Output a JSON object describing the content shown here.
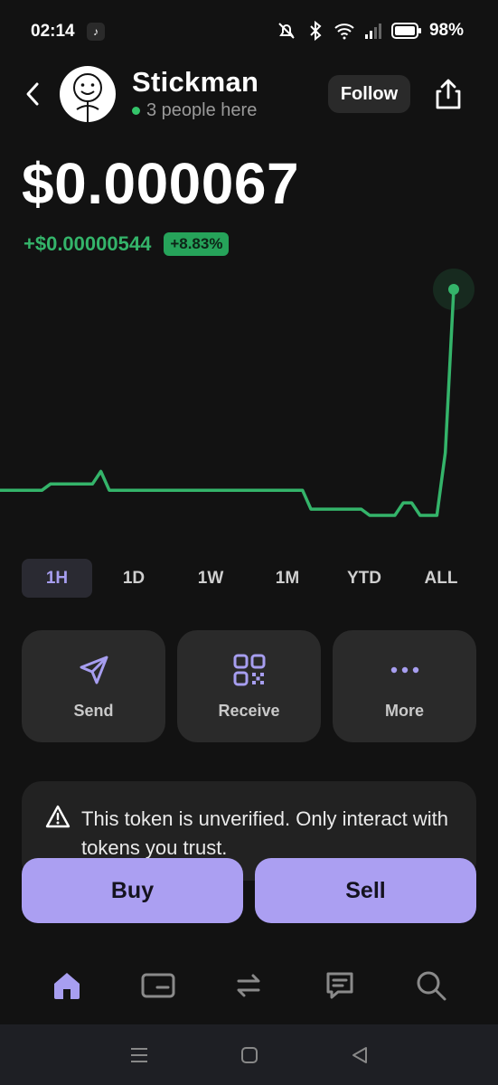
{
  "status_bar": {
    "time": "02:14",
    "battery": "98%",
    "icons": [
      "tiktok-icon",
      "mute-bell-icon",
      "bluetooth-icon",
      "wifi-icon",
      "signal-icon",
      "battery-icon"
    ]
  },
  "header": {
    "back_icon": "chevron-left-icon",
    "title": "Stickman",
    "presence": "3 people here",
    "follow_label": "Follow",
    "share_icon": "share-icon"
  },
  "token": {
    "price": "$0.000067",
    "change_abs": "+$0.00000544",
    "change_pct": "+8.83%"
  },
  "chart_data": {
    "type": "line",
    "color": "#34b46a",
    "values": [
      50,
      50,
      50,
      50,
      50,
      50,
      51,
      51,
      51,
      51,
      51,
      51,
      53,
      50,
      50,
      50,
      50,
      50,
      50,
      50,
      50,
      50,
      50,
      50,
      50,
      50,
      50,
      50,
      50,
      50,
      50,
      50,
      50,
      50,
      50,
      50,
      50,
      47,
      47,
      47,
      47,
      47,
      47,
      47,
      46,
      46,
      46,
      46,
      48,
      48,
      46,
      46,
      46,
      56,
      82
    ]
  },
  "ranges": [
    "1H",
    "1D",
    "1W",
    "1M",
    "YTD",
    "ALL"
  ],
  "active_range": "1H",
  "actions": [
    {
      "label": "Send",
      "icon": "send-icon"
    },
    {
      "label": "Receive",
      "icon": "qr-code-icon"
    },
    {
      "label": "More",
      "icon": "more-dots-icon"
    }
  ],
  "warning": {
    "icon": "warning-icon",
    "text": "This token is unverified. Only interact with tokens you trust."
  },
  "trade": {
    "buy_label": "Buy",
    "sell_label": "Sell"
  },
  "tab_bar": [
    "home-icon",
    "wallet-icon",
    "swap-icon",
    "chat-icon",
    "search-icon"
  ],
  "system_nav": [
    "recents-icon",
    "home-circle-icon",
    "back-icon"
  ],
  "colors": {
    "background": "#121212",
    "accent": "#ab9ff2",
    "positive": "#34b46a",
    "card": "#2a2a2a"
  }
}
